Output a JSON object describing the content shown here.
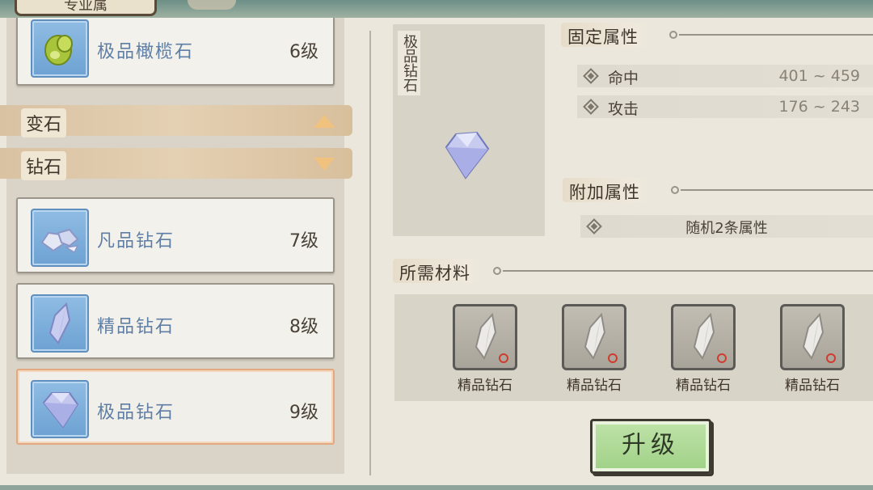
{
  "title_tab": "专业属",
  "list": {
    "top_item": {
      "name": "极品橄榄石",
      "level": "6级"
    },
    "categories": [
      {
        "label": "变石",
        "state": "expanded",
        "arrow": "up-arrow-icon"
      },
      {
        "label": "钻石",
        "state": "collapsed",
        "arrow": "down-arrow-icon"
      }
    ],
    "items": [
      {
        "name": "凡品钻石",
        "level": "7级"
      },
      {
        "name": "精品钻石",
        "level": "8级"
      },
      {
        "name": "极品钻石",
        "level": "9级",
        "selected": true
      }
    ]
  },
  "preview": {
    "name": "极品钻石"
  },
  "fixed_attrs": {
    "header": "固定属性",
    "rows": [
      {
        "name": "命中",
        "value": "401 ~ 459"
      },
      {
        "name": "攻击",
        "value": "176 ~ 243"
      }
    ]
  },
  "extra_attrs": {
    "header": "附加属性",
    "rows": [
      {
        "text": "随机2条属性"
      }
    ]
  },
  "materials": {
    "header": "所需材料",
    "items": [
      {
        "name": "精品钻石",
        "count": "0"
      },
      {
        "name": "精品钻石",
        "count": "0"
      },
      {
        "name": "精品钻石",
        "count": "0"
      },
      {
        "name": "精品钻石",
        "count": "0"
      }
    ]
  },
  "upgrade_button": "升级",
  "colors": {
    "accent_green": "#9fd186",
    "gem_blue": "#6ea2d3",
    "selected_border": "#e2a87f",
    "count_red": "#d13b2e"
  }
}
